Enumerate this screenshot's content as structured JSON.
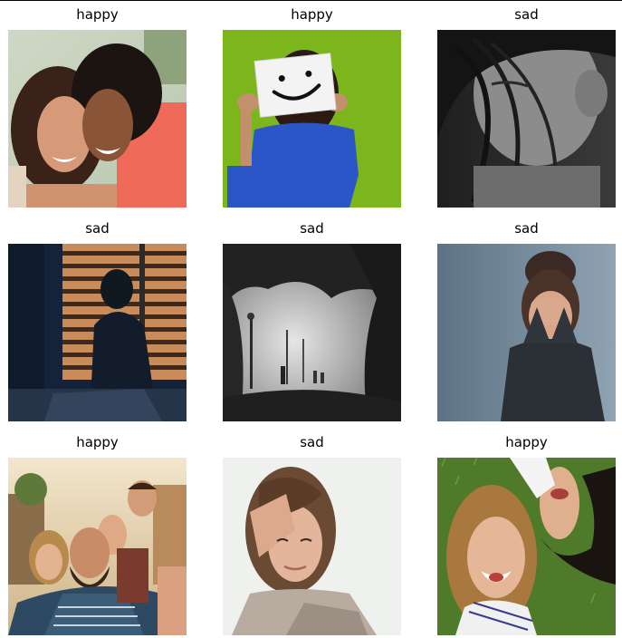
{
  "grid": {
    "tiles": [
      {
        "label": "happy",
        "image": "two-women-laughing-photo"
      },
      {
        "label": "happy",
        "image": "smiley-sign-woman-photo"
      },
      {
        "label": "sad",
        "image": "bw-woman-hair-face-photo"
      },
      {
        "label": "sad",
        "image": "man-head-in-hands-window-photo"
      },
      {
        "label": "sad",
        "image": "foggy-park-lamps-photo"
      },
      {
        "label": "sad",
        "image": "woman-hands-over-face-photo"
      },
      {
        "label": "happy",
        "image": "group-selfie-friends-photo"
      },
      {
        "label": "sad",
        "image": "woman-hand-on-head-photo"
      },
      {
        "label": "happy",
        "image": "two-women-lying-grass-photo"
      }
    ]
  }
}
